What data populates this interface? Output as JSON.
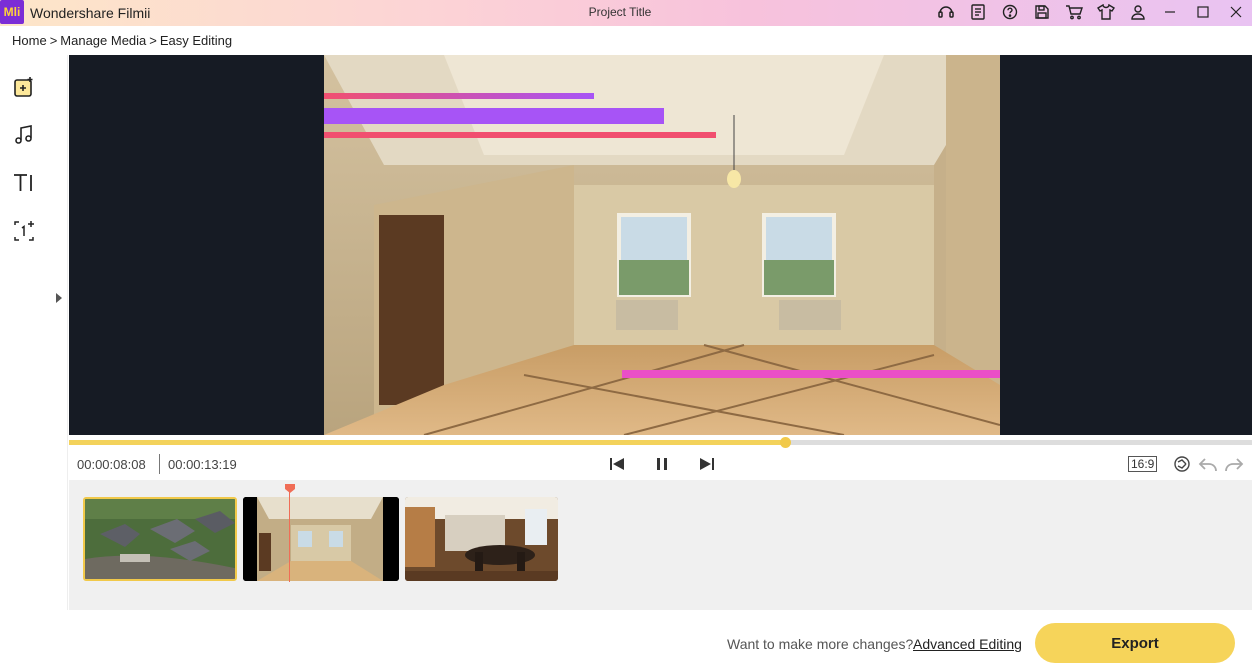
{
  "app": {
    "logo_text": "Mli",
    "title": "Wondershare Filmii",
    "project_title": "Project Title"
  },
  "titlebar_icons": [
    "support-icon",
    "notes-icon",
    "help-icon",
    "save-icon",
    "cart-icon",
    "theme-icon",
    "account-icon"
  ],
  "window_controls": [
    "minimize-icon",
    "maximize-icon",
    "close-icon"
  ],
  "breadcrumb": {
    "home": "Home",
    "manage": "Manage Media",
    "current": "Easy Editing",
    "separator": ">"
  },
  "left_tools": [
    "add-media-icon",
    "music-icon",
    "text-icon",
    "counter-icon"
  ],
  "preview": {
    "overlay_colors": [
      "#f14f6f",
      "#a754f6",
      "#f14f6f",
      "#ea4fc7"
    ]
  },
  "playback": {
    "current_time": "00:00:08:08",
    "total_time": "00:00:13:19",
    "progress": 0.605,
    "aspect_ratio": "16:9"
  },
  "timeline": {
    "clips": [
      {
        "name": "aerial-houses",
        "selected": true
      },
      {
        "name": "empty-room",
        "selected": false
      },
      {
        "name": "kitchen-dining",
        "selected": false
      }
    ]
  },
  "bottom": {
    "prompt": "Want to make more changes?",
    "advanced_label": "Advanced Editing",
    "export_label": "Export"
  },
  "colors": {
    "accent": "#f6d45a",
    "playhead": "#f06d56",
    "preview_bg": "#161b24"
  }
}
